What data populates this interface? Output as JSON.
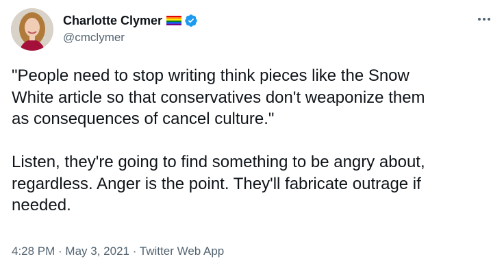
{
  "tweet": {
    "author": {
      "display_name": "Charlotte Clymer",
      "handle": "@cmclymer",
      "badges": [
        "rainbow-flag-icon",
        "verified-icon"
      ]
    },
    "text": [
      "\"People need to stop writing think pieces like the Snow\nWhite article so that conservatives don't weaponize them\nas consequences of cancel culture.\"",
      "Listen, they're going to find something to be angry about,\nregardless. Anger is the point. They'll fabricate outrage if\nneeded."
    ],
    "meta": {
      "time": "4:28 PM",
      "separator": " · ",
      "date": "May 3, 2021",
      "source": "Twitter Web App"
    }
  },
  "colors": {
    "text_primary": "#0f1419",
    "text_secondary": "#536471",
    "verified_blue": "#1d9bf0"
  }
}
